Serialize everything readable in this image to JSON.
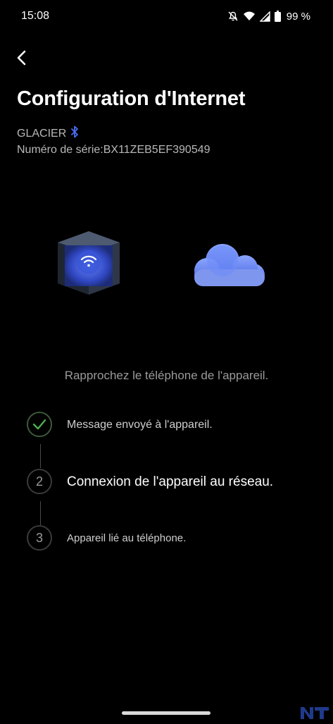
{
  "status_bar": {
    "time": "15:08",
    "battery_percent": "99 %",
    "icons": [
      "notifications-off-icon",
      "wifi-icon",
      "signal-icon",
      "battery-icon"
    ]
  },
  "header": {
    "back_icon": "chevron-left-icon",
    "title": "Configuration d'Internet"
  },
  "device": {
    "name": "GLACIER",
    "connection_icon": "bluetooth-icon",
    "serial": "Numéro de série:BX11ZEB5EF390549"
  },
  "illustration": {
    "left_icon": "wifi-device-cube-icon",
    "right_icon": "cloud-icon"
  },
  "hint": "Rapprochez le téléphone de l'appareil.",
  "steps": [
    {
      "marker": "✓",
      "label": "Message envoyé à l'appareil.",
      "state": "done"
    },
    {
      "marker": "2",
      "label": "Connexion de l'appareil au réseau.",
      "state": "active"
    },
    {
      "marker": "3",
      "label": "Appareil lié au téléphone.",
      "state": "pending"
    }
  ],
  "colors": {
    "background": "#000000",
    "accent_blue": "#4a6cf0",
    "check_green": "#4caf50"
  }
}
